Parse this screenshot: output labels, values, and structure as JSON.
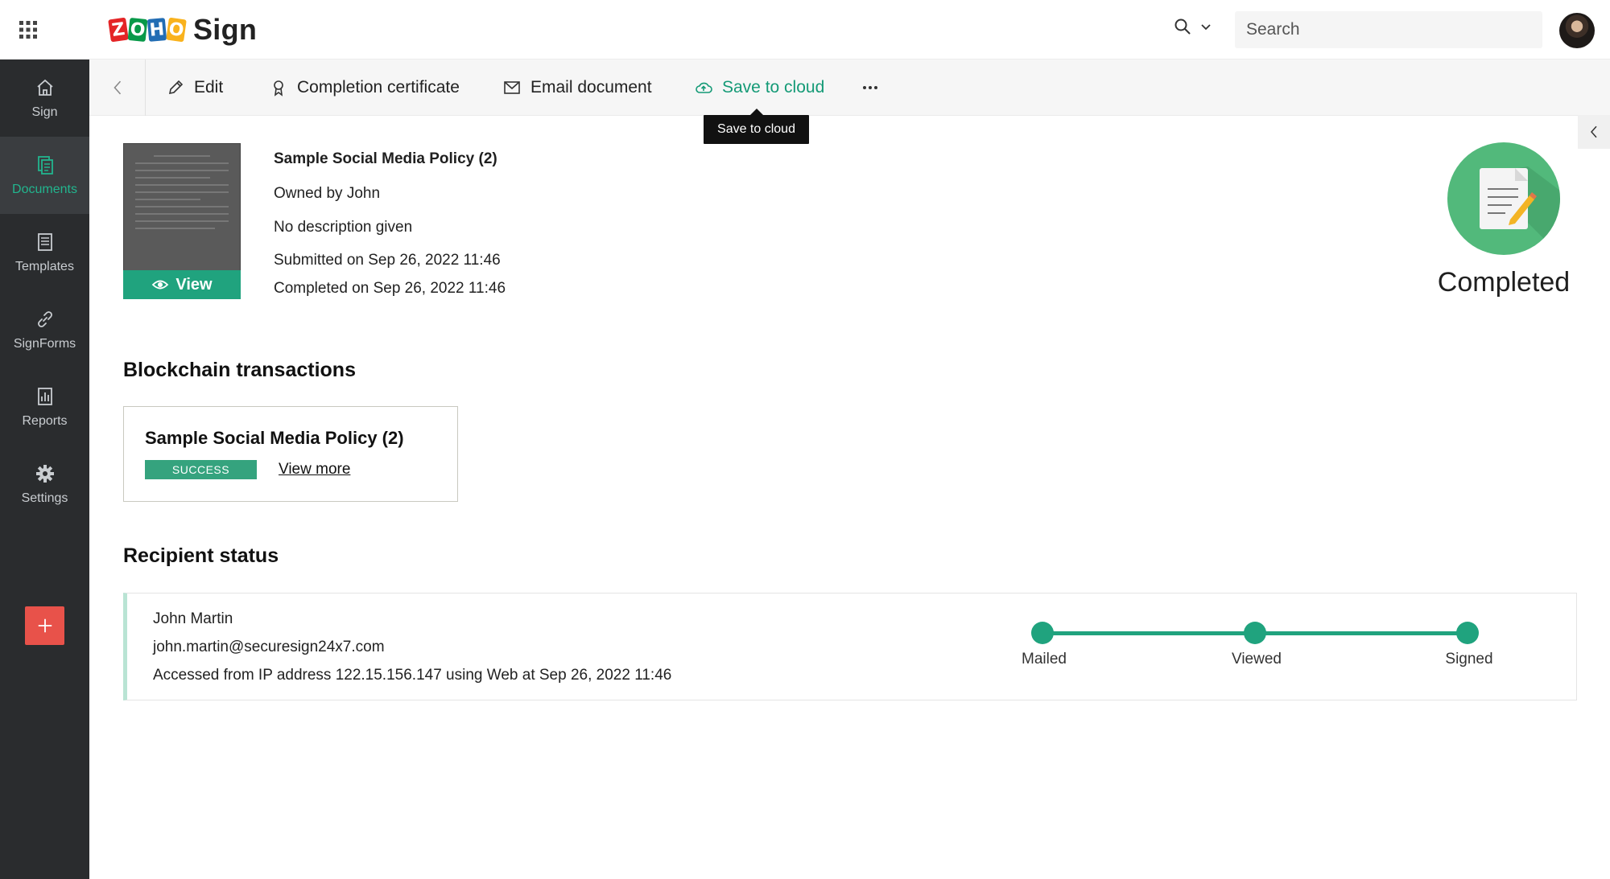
{
  "header": {
    "logo_letters": [
      "Z",
      "O",
      "H",
      "O"
    ],
    "product": "Sign",
    "search_placeholder": "Search"
  },
  "sidebar": {
    "items": [
      {
        "label": "Sign",
        "icon": "home-icon"
      },
      {
        "label": "Documents",
        "icon": "documents-icon",
        "active": true
      },
      {
        "label": "Templates",
        "icon": "templates-icon"
      },
      {
        "label": "SignForms",
        "icon": "link-icon"
      },
      {
        "label": "Reports",
        "icon": "reports-icon"
      },
      {
        "label": "Settings",
        "icon": "gear-icon"
      }
    ],
    "add_icon": "plus-icon"
  },
  "toolbar": {
    "edit": "Edit",
    "certificate": "Completion certificate",
    "email": "Email document",
    "save_cloud": "Save to cloud",
    "tooltip": "Save to cloud"
  },
  "document": {
    "title": "Sample Social Media Policy (2)",
    "owner": "Owned by John",
    "description": "No description given",
    "submitted": "Submitted on Sep 26, 2022 11:46",
    "completed": "Completed on Sep 26, 2022 11:46",
    "view_label": "View",
    "status": "Completed"
  },
  "blockchain": {
    "section_title": "Blockchain transactions",
    "name": "Sample Social Media Policy (2)",
    "badge": "SUCCESS",
    "link": "View more"
  },
  "recipients": {
    "section_title": "Recipient status",
    "name": "John Martin",
    "email": "john.martin@securesign24x7.com",
    "access": "Accessed from IP address 122.15.156.147 using Web at Sep 26, 2022 11:46",
    "steps": [
      "Mailed",
      "Viewed",
      "Signed"
    ]
  },
  "colors": {
    "accent": "#20a37e",
    "sidebar": "#2a2c2e",
    "add_button": "#e8524a"
  }
}
